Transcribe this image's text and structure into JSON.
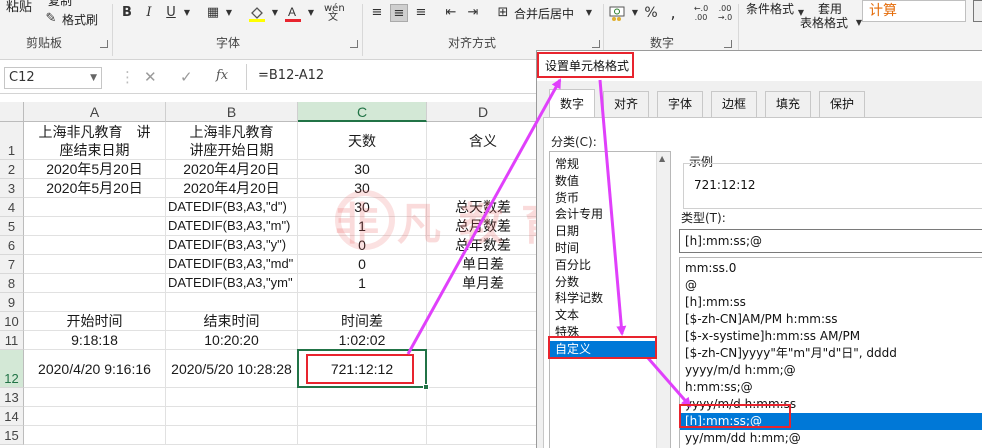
{
  "ribbon": {
    "paste_label": "粘贴",
    "copy_label": "复制",
    "format_painter_label": "格式刷",
    "groups": [
      "剪贴板",
      "字体",
      "对齐方式",
      "数字"
    ],
    "bold": "B",
    "italic": "I",
    "underline": "U",
    "merge_center_label": "合并后居中",
    "percent": "%",
    "comma": ",",
    "conditional_format_label": "条件格式",
    "table_format_label_1": "套用",
    "table_format_label_2": "表格格式",
    "style_calc": "计算",
    "font_color": "#e8242e",
    "fill_color": "#ffff00"
  },
  "formula_bar": {
    "name_box": "C12",
    "formula": "=B12-A12",
    "fx": "fx"
  },
  "sheet": {
    "columns": [
      "A",
      "B",
      "C",
      "D"
    ],
    "selected_column": "C",
    "rows": [
      {
        "num": "1",
        "a1": "上海非凡教育　讲",
        "a2": "座结束日期",
        "b1": "上海非凡教育",
        "b2": "讲座开始日期",
        "c": "天数",
        "d": "含义"
      },
      {
        "num": "2",
        "a": "2020年5月20日",
        "b": "2020年4月20日",
        "c": "30",
        "d": ""
      },
      {
        "num": "3",
        "a": "2020年5月20日",
        "b": "2020年4月20日",
        "c": "30",
        "d": ""
      },
      {
        "num": "4",
        "a": "",
        "b": "DATEDIF(B3,A3,\"d\")",
        "c": "30",
        "d": "总天数差"
      },
      {
        "num": "5",
        "a": "",
        "b": "DATEDIF(B3,A3,\"m\")",
        "c": "1",
        "d": "总月数差"
      },
      {
        "num": "6",
        "a": "",
        "b": "DATEDIF(B3,A3,\"y\")",
        "c": "0",
        "d": "总年数差"
      },
      {
        "num": "7",
        "a": "",
        "b": "DATEDIF(B3,A3,\"md\"",
        "c": "0",
        "d": "单日差"
      },
      {
        "num": "8",
        "a": "",
        "b": "DATEDIF(B3,A3,\"ym\"",
        "c": "1",
        "d": "单月差"
      },
      {
        "num": "9",
        "a": "",
        "b": "",
        "c": "",
        "d": ""
      },
      {
        "num": "10",
        "a": "开始时间",
        "b": "结束时间",
        "c": "时间差",
        "d": ""
      },
      {
        "num": "11",
        "a": "9:18:18",
        "b": "10:20:20",
        "c": "1:02:02",
        "d": ""
      },
      {
        "num": "12",
        "a": "2020/4/20 9:16:16",
        "b": "2020/5/20 10:28:28",
        "c": "721:12:12",
        "d": ""
      },
      {
        "num": "13",
        "a": "",
        "b": "",
        "c": "",
        "d": ""
      },
      {
        "num": "14",
        "a": "",
        "b": "",
        "c": "",
        "d": ""
      },
      {
        "num": "15",
        "a": "",
        "b": "",
        "c": "",
        "d": ""
      }
    ],
    "watermark": "非凡教育"
  },
  "dialog": {
    "title": "设置单元格格式",
    "tabs": [
      "数字",
      "对齐",
      "字体",
      "边框",
      "填充",
      "保护"
    ],
    "active_tab": "数字",
    "category_label": "分类(C):",
    "categories": [
      "常规",
      "数值",
      "货币",
      "会计专用",
      "日期",
      "时间",
      "百分比",
      "分数",
      "科学记数",
      "文本",
      "特殊",
      "自定义"
    ],
    "selected_category": "自定义",
    "sample_label": "示例",
    "sample_value": "721:12:12",
    "type_label": "类型(T):",
    "type_value": "[h]:mm:ss;@",
    "type_options": [
      "mm:ss.0",
      "@",
      "[h]:mm:ss",
      "[$-zh-CN]AM/PM h:mm:ss",
      "[$-x-systime]h:mm:ss AM/PM",
      "[$-zh-CN]yyyy\"年\"m\"月\"d\"日\", dddd",
      "yyyy/m/d h:mm;@",
      "h:mm:ss;@",
      "yyyy/m/d h:mm:ss",
      "[h]:mm:ss;@",
      "yy/mm/dd h:mm;@"
    ],
    "selected_type": "[h]:mm:ss;@"
  },
  "annotations": {
    "highlight_color": "#e8242e",
    "arrow_color": "#e040fb"
  }
}
